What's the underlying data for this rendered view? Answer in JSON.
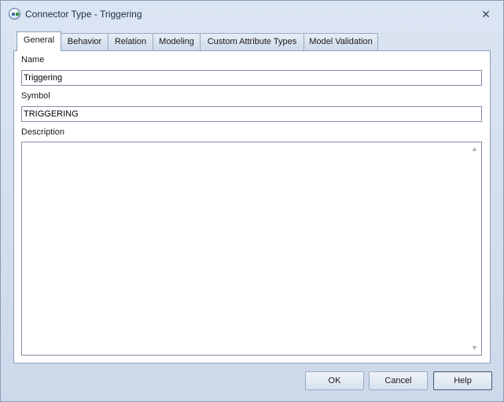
{
  "window": {
    "title": "Connector Type - Triggering",
    "close_glyph": "✕"
  },
  "tabs": [
    {
      "label": "General",
      "active": true
    },
    {
      "label": "Behavior"
    },
    {
      "label": "Relation"
    },
    {
      "label": "Modeling"
    },
    {
      "label": "Custom Attribute Types"
    },
    {
      "label": "Model Validation"
    }
  ],
  "form": {
    "name_label": "Name",
    "name_value": "Triggering",
    "symbol_label": "Symbol",
    "symbol_value": "TRIGGERING",
    "description_label": "Description",
    "description_value": ""
  },
  "scroll": {
    "up_glyph": "▲",
    "down_glyph": "▼"
  },
  "buttons": {
    "ok": "OK",
    "cancel": "Cancel",
    "help": "Help"
  },
  "colors": {
    "frame": "#cdd9ea",
    "tab_border": "#8aa0bf",
    "panel": "#ffffff"
  }
}
